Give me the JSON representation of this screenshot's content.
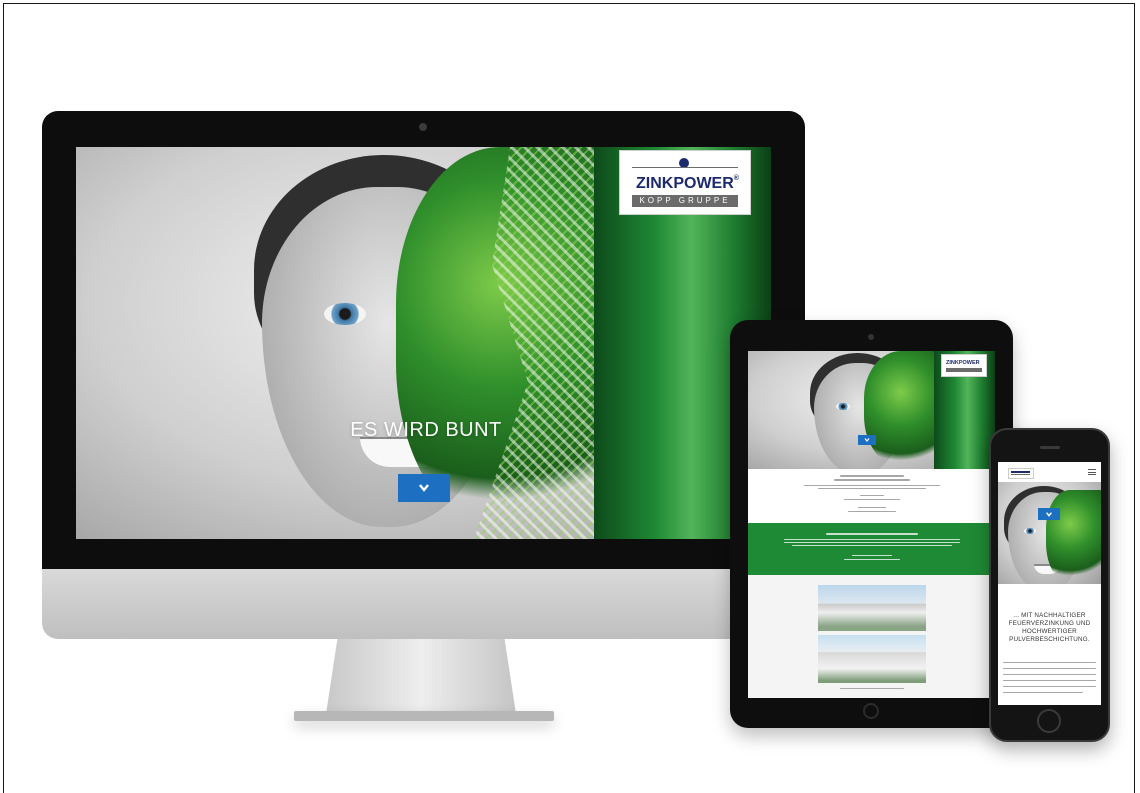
{
  "brand": {
    "name": "ZINKPOWER",
    "trademark": "®",
    "subline": "KOPP GRUPPE",
    "green": "#1f8a35",
    "navy": "#1d2a6e",
    "button_blue": "#1d6fc2"
  },
  "desktop": {
    "hero_title": "ES WIRD BUNT",
    "scroll_button_icon": "chevron-down-icon"
  },
  "phone": {
    "heading": "... MIT NACHHALTIGER FEUERVERZINKUNG UND HOCHWERTIGER PULVERBESCHICHTUNG.",
    "scroll_button_icon": "chevron-down-icon"
  }
}
